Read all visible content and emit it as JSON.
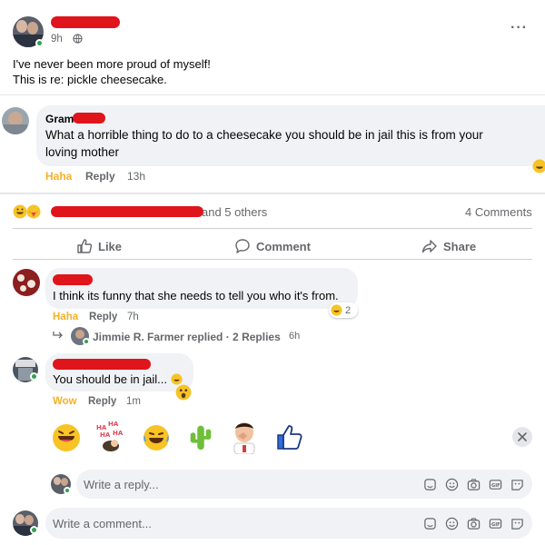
{
  "post": {
    "time": "9h",
    "body_line1": "I've never been more proud of myself!",
    "body_line2": "This is re: pickle cheesecake.",
    "more": "···"
  },
  "top_comment": {
    "author": "Gram",
    "text_line1": "What a horrible thing to do to a cheesecake you should be in jail this is from your",
    "text_line2": "loving mother",
    "reaction_label": "Haha",
    "reply_label": "Reply",
    "time": "13h"
  },
  "summary": {
    "and_others": "and 5 others",
    "comments_count": "4 Comments"
  },
  "actions": {
    "like": "Like",
    "comment": "Comment",
    "share": "Share"
  },
  "comment1": {
    "text": "I think its funny that she needs to tell you who it's from.",
    "reaction_label": "Haha",
    "reply_label": "Reply",
    "time": "7h",
    "reaction_count": "2",
    "replied_text": "Jimmie R. Farmer replied · 2 Replies",
    "replied_time": "6h"
  },
  "comment2": {
    "text": "You should be in jail...",
    "reaction_label": "Wow",
    "reply_label": "Reply",
    "time": "1m"
  },
  "reply_input": {
    "placeholder": "Write a reply..."
  },
  "comment_input": {
    "placeholder": "Write a comment..."
  },
  "colors": {
    "redaction": "#e0141b",
    "haha": "#f7b125",
    "meta_gray": "#65676b",
    "bubble": "#f0f2f5",
    "online": "#31a24c"
  },
  "icons": {
    "reaction_picker": [
      "grin-emoji-icon",
      "haha-sticker-icon",
      "laugh-cry-emoji-icon",
      "cactus-sticker-icon",
      "facepalm-sticker-icon",
      "thumbs-up-sticker-icon"
    ],
    "composer_tools": [
      "sticker-icon",
      "emoji-icon",
      "camera-icon",
      "gif-icon",
      "avatar-sticker-icon"
    ]
  }
}
